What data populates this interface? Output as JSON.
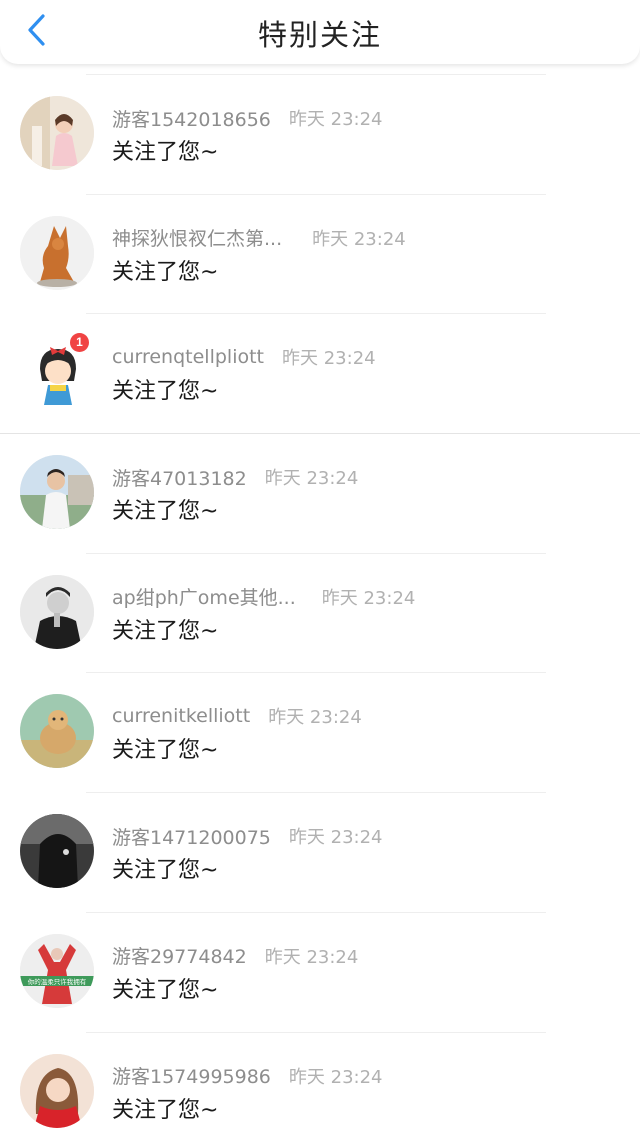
{
  "header": {
    "title": "特别关注",
    "back_icon": "chevron-left-icon",
    "accent_color": "#2f8ff0"
  },
  "items": [
    {
      "name": "游客1542018656",
      "time": "昨天 23:24",
      "message": "关注了您~",
      "avatar": "avatar-girl-photo"
    },
    {
      "name": "神探狄恨衩仁杰第...",
      "time": "昨天 23:24",
      "message": "关注了您~",
      "avatar": "avatar-dog-figurine"
    },
    {
      "name": "currenqtellpliott",
      "time": "昨天 23:24",
      "message": "关注了您~",
      "avatar": "avatar-cartoon-girl",
      "badge": "1"
    },
    {
      "name": "游客47013182",
      "time": "昨天 23:24",
      "message": "关注了您~",
      "avatar": "avatar-boy-photo"
    },
    {
      "name": "ap绀ph广ome其他...",
      "time": "昨天 23:24",
      "message": "关注了您~",
      "avatar": "avatar-man-bw"
    },
    {
      "name": "currenitkelliott",
      "time": "昨天 23:24",
      "message": "关注了您~",
      "avatar": "avatar-dog-field"
    },
    {
      "name": "游客1471200075",
      "time": "昨天 23:24",
      "message": "关注了您~",
      "avatar": "avatar-dark-hood"
    },
    {
      "name": "游客29774842",
      "time": "昨天 23:24",
      "message": "关注了您~",
      "avatar": "avatar-red-figure",
      "avatar_text": "你的温柔只许我拥有"
    },
    {
      "name": "游客1574995986",
      "time": "昨天 23:24",
      "message": "关注了您~",
      "avatar": "avatar-woman-scarf"
    }
  ]
}
